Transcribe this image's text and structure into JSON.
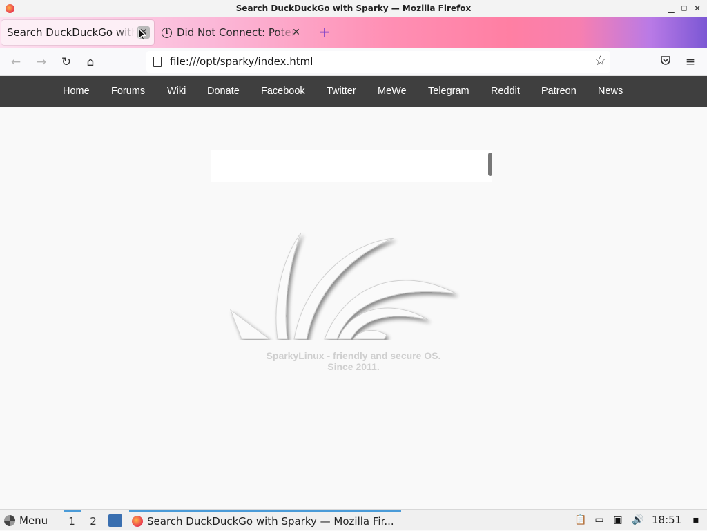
{
  "window": {
    "title": "Search DuckDuckGo with Sparky — Mozilla Firefox"
  },
  "tabs": [
    {
      "label": "Search DuckDuckGo with Sparky",
      "active": true
    },
    {
      "label": "Did Not Connect: Potential Security Issue",
      "active": false
    }
  ],
  "navbar": {
    "url": "file:///opt/sparky/index.html"
  },
  "site_nav": {
    "items": [
      "Home",
      "Forums",
      "Wiki",
      "Donate",
      "Facebook",
      "Twitter",
      "MeWe",
      "Telegram",
      "Reddit",
      "Patreon",
      "News"
    ]
  },
  "main": {
    "search_value": "",
    "tagline_line1": "SparkyLinux - friendly and secure OS.",
    "tagline_line2": "Since 2011."
  },
  "taskbar": {
    "menu_label": "Menu",
    "workspaces": [
      "1",
      "2"
    ],
    "task_label": "Search DuckDuckGo with Sparky — Mozilla Fir...",
    "clock": "18:51"
  },
  "colors": {
    "site_nav_bg": "#3f3f3f",
    "accent_blue": "#4a9bd8",
    "tab_gradient_pink": "#ff8fb4",
    "tab_gradient_purple": "#7b57d4"
  }
}
